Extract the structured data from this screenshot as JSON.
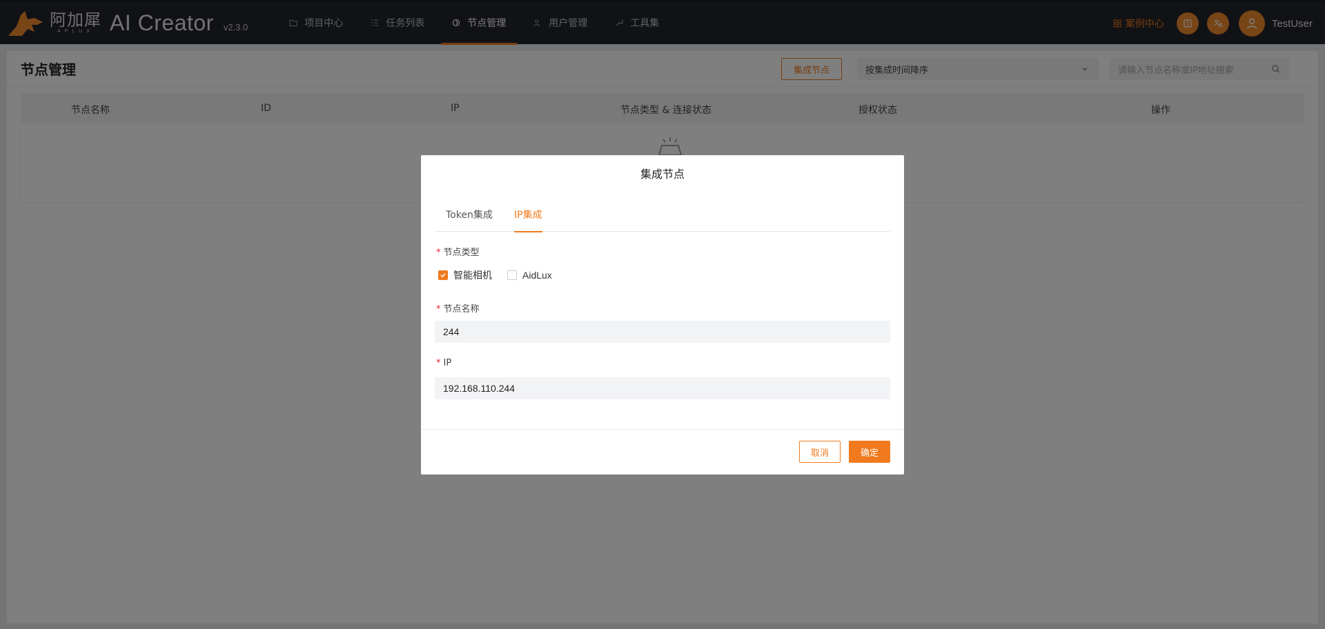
{
  "brand": {
    "cn_name": "阿加犀",
    "sub_name": "APLUX",
    "product": "AI Creator",
    "version": "v2.3.0"
  },
  "nav": {
    "items": [
      {
        "label": "项目中心",
        "icon": "folder-icon"
      },
      {
        "label": "任务列表",
        "icon": "list-icon"
      },
      {
        "label": "节点管理",
        "icon": "node-icon",
        "active": true
      },
      {
        "label": "用户管理",
        "icon": "users-icon"
      },
      {
        "label": "工具集",
        "icon": "tools-icon"
      }
    ],
    "case_center": "案例中心",
    "username": "TestUser"
  },
  "page": {
    "title": "节点管理",
    "integrate_button": "集成节点",
    "sort_value": "按集成时间降序",
    "search_placeholder": "请输入节点名称或IP地址搜索",
    "table_headers": [
      "节点名称",
      "ID",
      "IP",
      "节点类型 & 连接状态",
      "授权状态",
      "操作"
    ]
  },
  "modal": {
    "title": "集成节点",
    "tabs": [
      {
        "label": "Token集成",
        "active": false
      },
      {
        "label": "IP集成",
        "active": true
      }
    ],
    "node_type_label": "节点类型",
    "node_types": [
      {
        "label": "智能相机",
        "checked": true
      },
      {
        "label": "AidLux",
        "checked": false
      }
    ],
    "node_name_label": "节点名称",
    "node_name_value": "244",
    "ip_label": "IP",
    "ip_value": "192.168.110.244",
    "cancel_label": "取消",
    "ok_label": "确定"
  },
  "colors": {
    "accent": "#f07a1d",
    "topbar": "#22252c",
    "required": "#f5222d"
  }
}
